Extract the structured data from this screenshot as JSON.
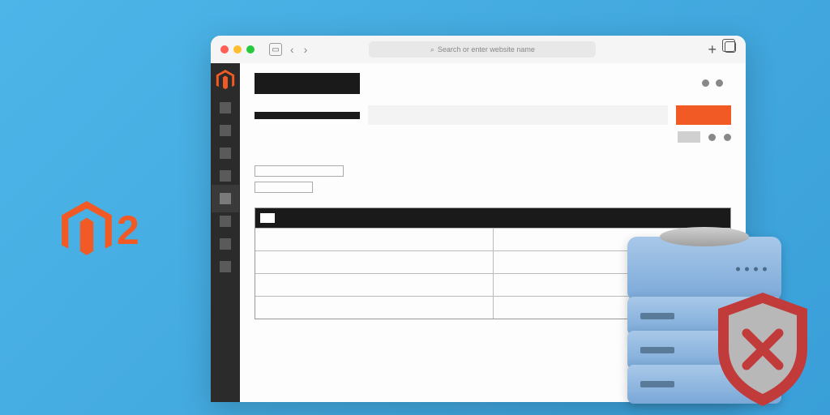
{
  "branding": {
    "product_suffix": "2",
    "logo_color": "#f15a24"
  },
  "browser": {
    "search_placeholder": "Search or enter website name"
  },
  "sidebar": {
    "items": [
      {
        "active": false
      },
      {
        "active": false
      },
      {
        "active": false
      },
      {
        "active": false
      },
      {
        "active": true
      },
      {
        "active": false
      },
      {
        "active": false
      },
      {
        "active": false
      }
    ]
  },
  "content": {
    "cta_color": "#f15a24",
    "table_rows": 4,
    "table_cols": 2
  },
  "illustration": {
    "server_layers": 4,
    "shield_status": "blocked"
  }
}
